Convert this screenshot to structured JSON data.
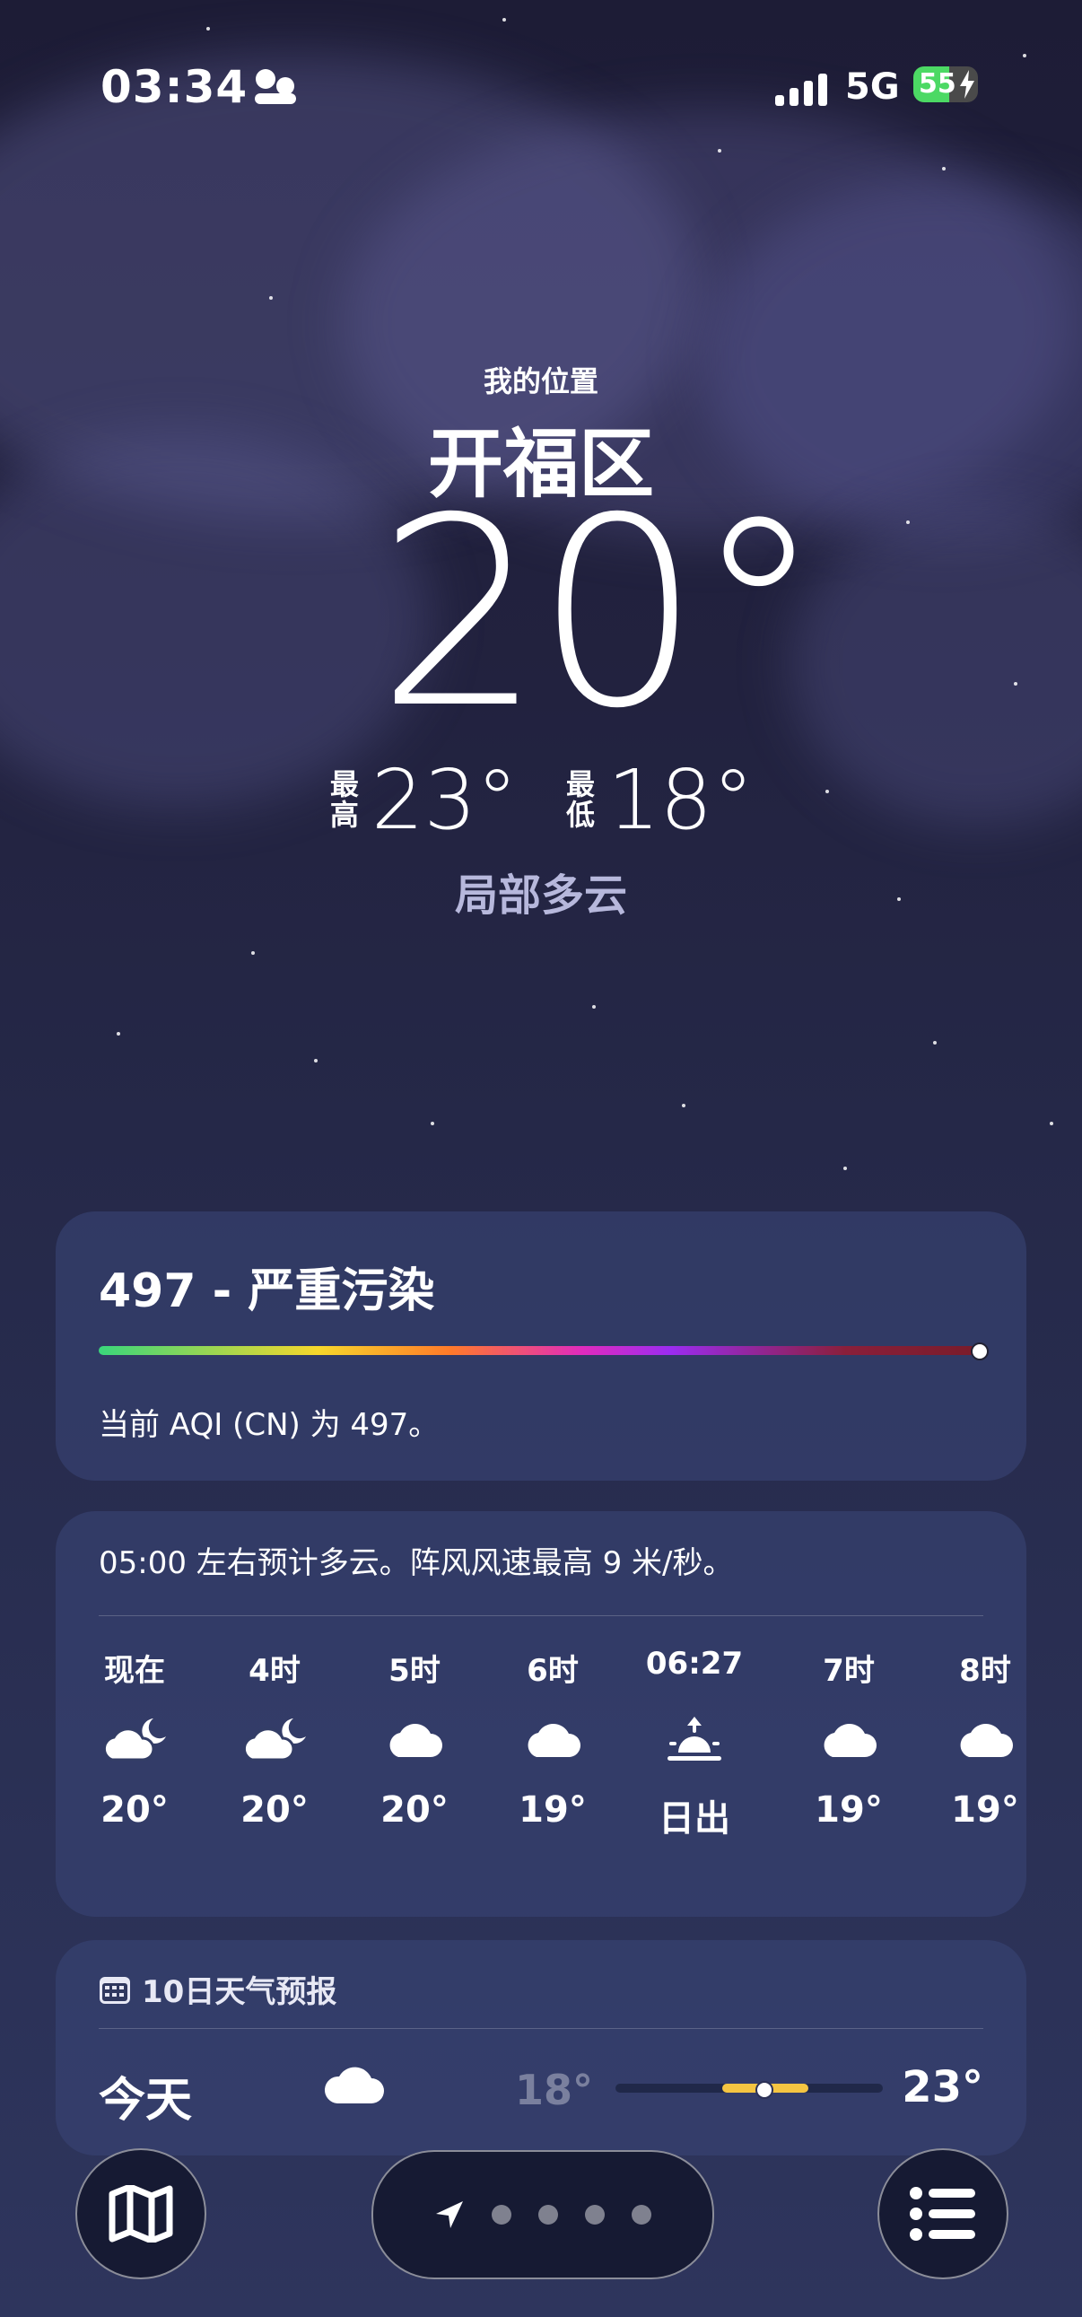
{
  "status_bar": {
    "time": "03:34",
    "network": "5G",
    "battery": "55",
    "battery_level": 0.55
  },
  "header": {
    "location_label": "我的位置",
    "city": "开福区",
    "temperature": "20°",
    "high_label": "最高",
    "high": "23°",
    "low_label": "最低",
    "low": "18°",
    "condition": "局部多云"
  },
  "aqi": {
    "title": "497 - 严重污染",
    "description": "当前 AQI (CN) 为 497。",
    "indicator_fraction": 1.0
  },
  "hourly": {
    "description": "05:00 左右预计多云。阵风风速最高 9 米/秒。",
    "items": [
      {
        "label": "现在",
        "icon": "cloud-moon-icon",
        "temp": "20°"
      },
      {
        "label": "4时",
        "icon": "cloud-moon-icon",
        "temp": "20°"
      },
      {
        "label": "5时",
        "icon": "cloud-icon",
        "temp": "20°"
      },
      {
        "label": "6时",
        "icon": "cloud-icon",
        "temp": "19°"
      },
      {
        "label": "06:27",
        "icon": "sunrise-icon",
        "temp": "日出"
      },
      {
        "label": "7时",
        "icon": "cloud-icon",
        "temp": "19°"
      },
      {
        "label": "8时",
        "icon": "cloud-icon",
        "temp": "19°"
      }
    ]
  },
  "forecast": {
    "title": "10日天气预报",
    "rows": [
      {
        "day": "今天",
        "icon": "cloud-icon",
        "low": "18°",
        "high": "23°",
        "range_start_fraction": 0.4,
        "range_end_fraction": 0.72,
        "current_fraction": 0.55
      }
    ]
  },
  "colors": {
    "background": "#22223f",
    "card": "#384474",
    "accent_yellow": "#f5c542",
    "battery_green": "#4cd964"
  }
}
